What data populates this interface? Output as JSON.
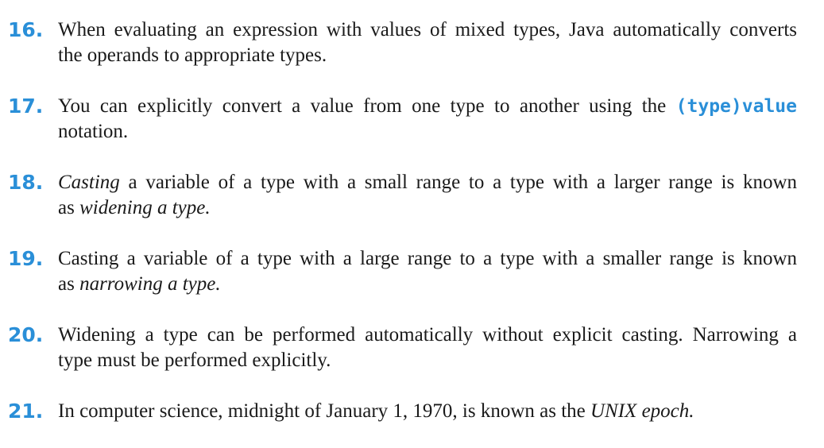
{
  "items": [
    {
      "number": "16.",
      "line1": "When evaluating an expression with values of mixed types, Java automatically converts",
      "line2": "the operands to appropriate types."
    },
    {
      "number": "17.",
      "line1_pre": "You can explicitly convert a value from one type to another using the ",
      "line1_code": "(type)value",
      "line2": "notation."
    },
    {
      "number": "18.",
      "line1_italic": "Casting",
      "line1_rest": " a variable of a type with a small range to a type with a larger range is known",
      "line2_pre": "as ",
      "line2_italic": "widening a type."
    },
    {
      "number": "19.",
      "line1": "Casting a variable of a type with a large range to a type with a smaller range is known",
      "line2_pre": "as ",
      "line2_italic": "narrowing a type."
    },
    {
      "number": "20.",
      "line1": "Widening a type can be performed automatically without explicit casting. Narrowing a",
      "line2": "type must be performed explicitly."
    },
    {
      "number": "21.",
      "line1_pre": "In computer science, midnight of January 1, 1970, is known as the ",
      "line1_italic": "UNIX epoch."
    }
  ],
  "colors": {
    "accent": "#2a8fd8",
    "text": "#1a1a1a"
  }
}
